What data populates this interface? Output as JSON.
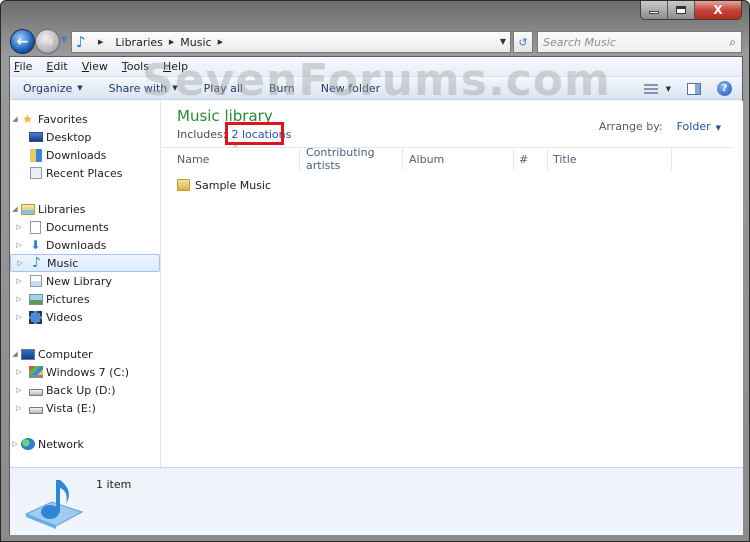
{
  "window": {
    "caption_buttons": [
      {
        "name": "minimize",
        "glyph": "—"
      },
      {
        "name": "maximize",
        "glyph": "□"
      },
      {
        "name": "close",
        "glyph": "X"
      }
    ]
  },
  "nav": {
    "back_glyph": "←",
    "forward_glyph": "→",
    "history_glyph": "▼",
    "address_icon": "music-note-icon",
    "breadcrumb": [
      "Libraries",
      "Music"
    ],
    "crumb_arrow": "▶",
    "address_dropdown_glyph": "▼",
    "refresh_glyph": "↺",
    "search_placeholder": "Search Music",
    "search_glyph": "⌕"
  },
  "menubar": {
    "items": [
      {
        "accel": "F",
        "rest": "ile"
      },
      {
        "accel": "E",
        "rest": "dit"
      },
      {
        "accel": "V",
        "rest": "iew"
      },
      {
        "accel": "T",
        "rest": "ools"
      },
      {
        "accel": "H",
        "rest": "elp"
      }
    ]
  },
  "watermark": "SevenForums.com",
  "toolbar": {
    "organize": "Organize",
    "share_with": "Share with",
    "play_all": "Play all",
    "burn": "Burn",
    "new_folder": "New folder",
    "dropdown_glyph": "▼",
    "help_glyph": "?"
  },
  "navpane": {
    "favorites": {
      "label": "Favorites",
      "items": [
        "Desktop",
        "Downloads",
        "Recent Places"
      ]
    },
    "libraries": {
      "label": "Libraries",
      "items": [
        "Documents",
        "Downloads",
        "Music",
        "New Library",
        "Pictures",
        "Videos"
      ],
      "selected": "Music"
    },
    "computer": {
      "label": "Computer",
      "items": [
        "Windows 7 (C:)",
        "Back Up (D:)",
        "Vista (E:)"
      ]
    },
    "network": {
      "label": "Network"
    },
    "expanded_glyph": "◢",
    "collapsed_glyph": "▷"
  },
  "content": {
    "library_title": "Music library",
    "includes_label": "Includes:",
    "locations_link": "2 locations",
    "arrange_label": "Arrange by:",
    "arrange_value": "Folder",
    "columns": [
      "Name",
      "Contributing artists",
      "Album",
      "#",
      "Title"
    ],
    "sort_glyph": "^",
    "files": [
      {
        "name": "Sample Music",
        "type": "folder"
      }
    ]
  },
  "details": {
    "item_count": "1 item"
  },
  "colors": {
    "library_title": "#2a8a34",
    "link": "#1d54a8",
    "highlight_box": "#e0141e",
    "selection_border": "#a7c4ea"
  }
}
